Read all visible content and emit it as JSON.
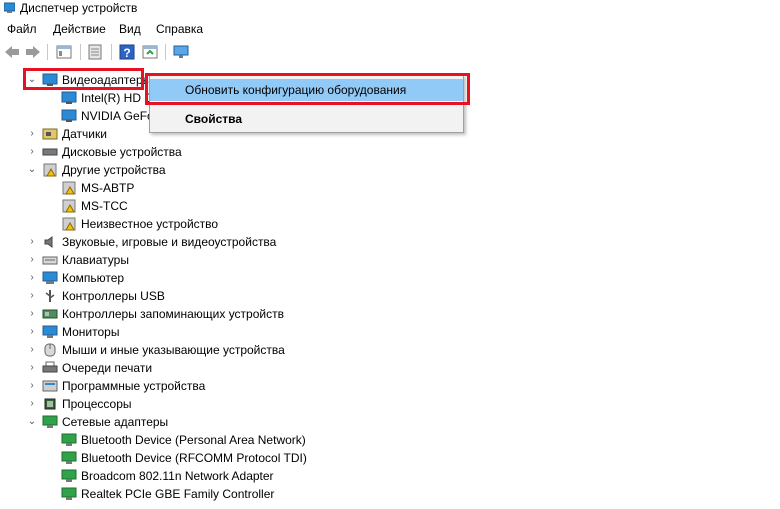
{
  "window": {
    "title": "Диспетчер устройств"
  },
  "menu": [
    "Файл",
    "Действие",
    "Вид",
    "Справка"
  ],
  "toolbar_icons": [
    "back-arrow-icon",
    "forward-arrow-icon",
    "properties-icon",
    "scan-icon",
    "help-icon",
    "driver-update-icon",
    "monitor-icon"
  ],
  "tree": {
    "video": {
      "label": "Видеоадаптеры",
      "children": [
        "Intel(R) HD G",
        "NVIDIA GeFo"
      ]
    },
    "sensors": "Датчики",
    "disks": "Дисковые устройства",
    "other": {
      "label": "Другие устройства",
      "children": [
        "MS-ABTP",
        "MS-TCC",
        "Неизвестное устройство"
      ]
    },
    "sound": "Звуковые, игровые и видеоустройства",
    "keyboards": "Клавиатуры",
    "computer": "Компьютер",
    "usb": "Контроллеры USB",
    "storage": "Контроллеры запоминающих устройств",
    "monitors": "Мониторы",
    "mice": "Мыши и иные указывающие устройства",
    "print": "Очереди печати",
    "software": "Программные устройства",
    "cpu": "Процессоры",
    "net": {
      "label": "Сетевые адаптеры",
      "children": [
        "Bluetooth Device (Personal Area Network)",
        "Bluetooth Device (RFCOMM Protocol TDI)",
        "Broadcom 802.11n Network Adapter",
        "Realtek PCIe GBE Family Controller"
      ]
    }
  },
  "context_menu": {
    "update": "Обновить конфигурацию оборудования",
    "properties": "Свойства"
  }
}
